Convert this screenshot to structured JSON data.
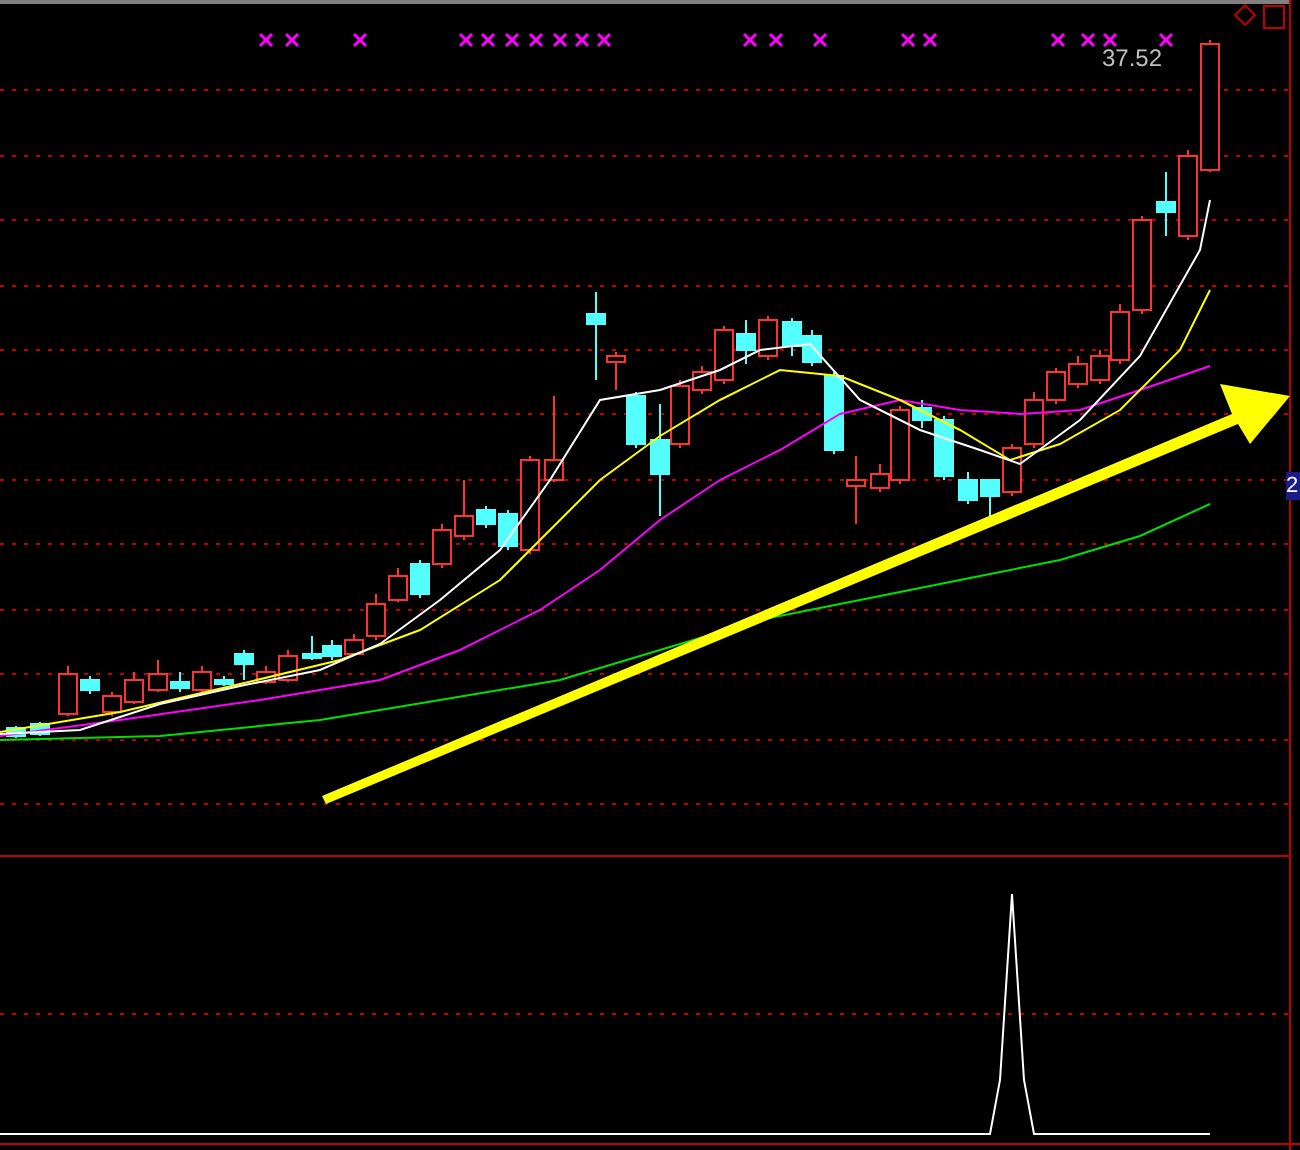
{
  "chart": {
    "price_label": "37.52"
  },
  "axis_tag": "2"
}
